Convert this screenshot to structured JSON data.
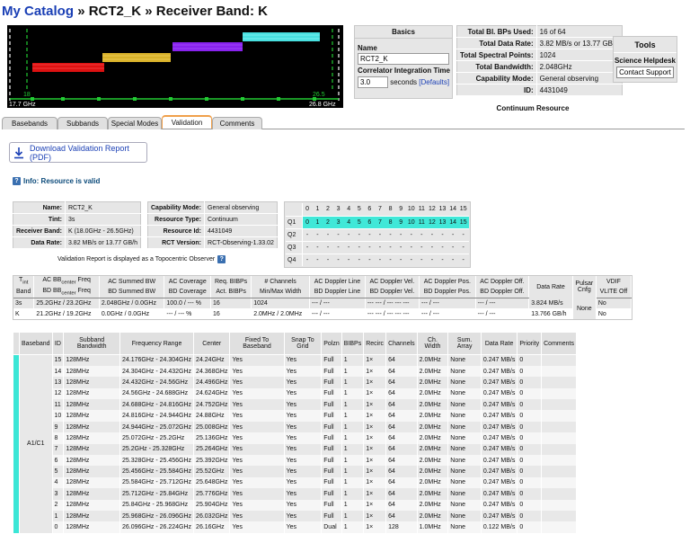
{
  "header": {
    "catalog_link": "My Catalog",
    "sep1": "»",
    "resource": "RCT2_K",
    "sep2": "»",
    "band": "Receiver Band: K"
  },
  "band_plot": {
    "left_freq": "17.7 GHz",
    "right_freq": "26.8 GHz",
    "left_marker": "18",
    "right_marker": "26.5",
    "colors": [
      "#ff3333",
      "#ffcc33",
      "#9933ff",
      "#66ffff"
    ]
  },
  "basics": {
    "title": "Basics",
    "name_label": "Name",
    "name_value": "RCT2_K",
    "cit_label": "Correlator Integration Time",
    "cit_value": "3.0",
    "cit_units": "seconds",
    "defaults_link": "[Defaults]"
  },
  "stats": [
    {
      "k": "Total Bl. BPs Used:",
      "v": "16 of 64"
    },
    {
      "k": "Total Data Rate:",
      "v": "3.82 MB/s or 13.77 GB/h"
    },
    {
      "k": "Total Spectral Points:",
      "v": "1024"
    },
    {
      "k": "Total Bandwidth:",
      "v": "2.048GHz"
    },
    {
      "k": "Capability Mode:",
      "v": "General observing"
    },
    {
      "k": "ID:",
      "v": "4431049"
    }
  ],
  "continuum_label": "Continuum Resource",
  "tools": {
    "title": "Tools",
    "helpdesk": "Science Helpdesk",
    "contact": "Contact Support"
  },
  "tabs": [
    {
      "label": "Basebands",
      "active": false
    },
    {
      "label": "Subbands",
      "active": false
    },
    {
      "label": "Special Modes",
      "active": false
    },
    {
      "label": "Validation",
      "active": true
    },
    {
      "label": "Comments",
      "active": false
    }
  ],
  "download_label": "Download Validation Report (PDF)",
  "info_text": "Info: Resource is valid",
  "summary_a": [
    {
      "k": "Name:",
      "v": "RCT2_K"
    },
    {
      "k": "Tint:",
      "v": "3s"
    },
    {
      "k": "Receiver Band:",
      "v": "K (18.0GHz - 26.5GHz)"
    },
    {
      "k": "Data Rate:",
      "v": "3.82 MB/s or 13.77 GB/h"
    }
  ],
  "summary_b": [
    {
      "k": "Capability Mode:",
      "v": "General observing"
    },
    {
      "k": "Resource Type:",
      "v": "Continuum"
    },
    {
      "k": "Resource Id:",
      "v": "4431049"
    },
    {
      "k": "RCT Version:",
      "v": "RCT-Observing-1.33.02"
    }
  ],
  "topo_note": "Validation Report is displayed as a Topocentric Observer",
  "quadrant_grid": {
    "cols": [
      "0",
      "1",
      "2",
      "3",
      "4",
      "5",
      "6",
      "7",
      "8",
      "9",
      "10",
      "11",
      "12",
      "13",
      "14",
      "15"
    ],
    "rows": [
      {
        "label": "Q1",
        "on": true,
        "cells": [
          "0",
          "1",
          "2",
          "3",
          "4",
          "5",
          "6",
          "7",
          "8",
          "9",
          "10",
          "11",
          "12",
          "13",
          "14",
          "15"
        ]
      },
      {
        "label": "Q2",
        "on": false,
        "cells": [
          "-",
          "-",
          "-",
          "-",
          "-",
          "-",
          "-",
          "-",
          "-",
          "-",
          "-",
          "-",
          "-",
          "-",
          "-",
          "-"
        ]
      },
      {
        "label": "Q3",
        "on": false,
        "cells": [
          "-",
          "-",
          "-",
          "-",
          "-",
          "-",
          "-",
          "-",
          "-",
          "-",
          "-",
          "-",
          "-",
          "-",
          "-",
          "-"
        ]
      },
      {
        "label": "Q4",
        "on": false,
        "cells": [
          "-",
          "-",
          "-",
          "-",
          "-",
          "-",
          "-",
          "-",
          "-",
          "-",
          "-",
          "-",
          "-",
          "-",
          "-",
          "-"
        ]
      }
    ]
  },
  "mid_table": {
    "head1": [
      "T",
      "AC BB",
      "AC Summed BW",
      "AC Coverage",
      "Req. BIBPs",
      "# Channels",
      "AC Doppler Line",
      "AC Doppler Vel.",
      "AC Doppler Pos.",
      "AC Doppler Off.",
      "Data Rate",
      "Pulsar Cnfg",
      "VDIF"
    ],
    "head1_sub": [
      "int",
      "center",
      "Freq"
    ],
    "head2": [
      "Band",
      "BD BB",
      "BD Summed BW",
      "BD Coverage",
      "Act. BIBPs",
      "Min/Max Width",
      "BD Doppler Line",
      "BD Doppler Vel.",
      "BD Doppler Pos.",
      "BD Doppler Off.",
      "VLITE Off"
    ],
    "rows": [
      [
        "3s",
        "25.2GHz / 23.2GHz",
        "2.048GHz / 0.0GHz",
        "100.0 / --- %",
        "16",
        "1024",
        "--- / ---",
        "--- --- / --- --- ---",
        "--- / ---",
        "--- / ---",
        "3.824 MB/s",
        "None",
        "No"
      ],
      [
        "K",
        "21.2GHz / 19.2GHz",
        "0.0GHz / 0.0GHz",
        "--- / --- %",
        "16",
        "2.0MHz / 2.0MHz",
        "--- / ---",
        "--- --- / --- --- ---",
        "--- / ---",
        "--- / ---",
        "13.766 GB/h",
        "",
        "No"
      ]
    ]
  },
  "baseband_table": {
    "headers": [
      "Baseband",
      "ID",
      "Subband Bandwidth",
      "Frequency Range",
      "Center",
      "Fixed To Baseband",
      "Snap To Grid",
      "Polzn",
      "BIBPs",
      "Recirc",
      "Channels",
      "Ch. Width",
      "Sum. Array",
      "Data Rate",
      "Priority",
      "Comments"
    ],
    "baseband_name": "A1/C1",
    "rows": [
      [
        "15",
        "128MHz",
        "24.176GHz - 24.304GHz",
        "24.24GHz",
        "Yes",
        "Yes",
        "Full",
        "1",
        "1×",
        "64",
        "2.0MHz",
        "None",
        "0.247 MB/s",
        "0",
        ""
      ],
      [
        "14",
        "128MHz",
        "24.304GHz - 24.432GHz",
        "24.368GHz",
        "Yes",
        "Yes",
        "Full",
        "1",
        "1×",
        "64",
        "2.0MHz",
        "None",
        "0.247 MB/s",
        "0",
        ""
      ],
      [
        "13",
        "128MHz",
        "24.432GHz - 24.56GHz",
        "24.496GHz",
        "Yes",
        "Yes",
        "Full",
        "1",
        "1×",
        "64",
        "2.0MHz",
        "None",
        "0.247 MB/s",
        "0",
        ""
      ],
      [
        "12",
        "128MHz",
        "24.56GHz - 24.688GHz",
        "24.624GHz",
        "Yes",
        "Yes",
        "Full",
        "1",
        "1×",
        "64",
        "2.0MHz",
        "None",
        "0.247 MB/s",
        "0",
        ""
      ],
      [
        "11",
        "128MHz",
        "24.688GHz - 24.816GHz",
        "24.752GHz",
        "Yes",
        "Yes",
        "Full",
        "1",
        "1×",
        "64",
        "2.0MHz",
        "None",
        "0.247 MB/s",
        "0",
        ""
      ],
      [
        "10",
        "128MHz",
        "24.816GHz - 24.944GHz",
        "24.88GHz",
        "Yes",
        "Yes",
        "Full",
        "1",
        "1×",
        "64",
        "2.0MHz",
        "None",
        "0.247 MB/s",
        "0",
        ""
      ],
      [
        "9",
        "128MHz",
        "24.944GHz - 25.072GHz",
        "25.008GHz",
        "Yes",
        "Yes",
        "Full",
        "1",
        "1×",
        "64",
        "2.0MHz",
        "None",
        "0.247 MB/s",
        "0",
        ""
      ],
      [
        "8",
        "128MHz",
        "25.072GHz - 25.2GHz",
        "25.136GHz",
        "Yes",
        "Yes",
        "Full",
        "1",
        "1×",
        "64",
        "2.0MHz",
        "None",
        "0.247 MB/s",
        "0",
        ""
      ],
      [
        "7",
        "128MHz",
        "25.2GHz - 25.328GHz",
        "25.264GHz",
        "Yes",
        "Yes",
        "Full",
        "1",
        "1×",
        "64",
        "2.0MHz",
        "None",
        "0.247 MB/s",
        "0",
        ""
      ],
      [
        "6",
        "128MHz",
        "25.328GHz - 25.456GHz",
        "25.392GHz",
        "Yes",
        "Yes",
        "Full",
        "1",
        "1×",
        "64",
        "2.0MHz",
        "None",
        "0.247 MB/s",
        "0",
        ""
      ],
      [
        "5",
        "128MHz",
        "25.456GHz - 25.584GHz",
        "25.52GHz",
        "Yes",
        "Yes",
        "Full",
        "1",
        "1×",
        "64",
        "2.0MHz",
        "None",
        "0.247 MB/s",
        "0",
        ""
      ],
      [
        "4",
        "128MHz",
        "25.584GHz - 25.712GHz",
        "25.648GHz",
        "Yes",
        "Yes",
        "Full",
        "1",
        "1×",
        "64",
        "2.0MHz",
        "None",
        "0.247 MB/s",
        "0",
        ""
      ],
      [
        "3",
        "128MHz",
        "25.712GHz - 25.84GHz",
        "25.776GHz",
        "Yes",
        "Yes",
        "Full",
        "1",
        "1×",
        "64",
        "2.0MHz",
        "None",
        "0.247 MB/s",
        "0",
        ""
      ],
      [
        "2",
        "128MHz",
        "25.84GHz - 25.968GHz",
        "25.904GHz",
        "Yes",
        "Yes",
        "Full",
        "1",
        "1×",
        "64",
        "2.0MHz",
        "None",
        "0.247 MB/s",
        "0",
        ""
      ],
      [
        "1",
        "128MHz",
        "25.968GHz - 26.096GHz",
        "26.032GHz",
        "Yes",
        "Yes",
        "Full",
        "1",
        "1×",
        "64",
        "2.0MHz",
        "None",
        "0.247 MB/s",
        "0",
        ""
      ],
      [
        "0",
        "128MHz",
        "26.096GHz - 26.224GHz",
        "26.16GHz",
        "Yes",
        "Yes",
        "Dual",
        "1",
        "1×",
        "128",
        "1.0MHz",
        "None",
        "0.122 MB/s",
        "0",
        ""
      ]
    ]
  }
}
